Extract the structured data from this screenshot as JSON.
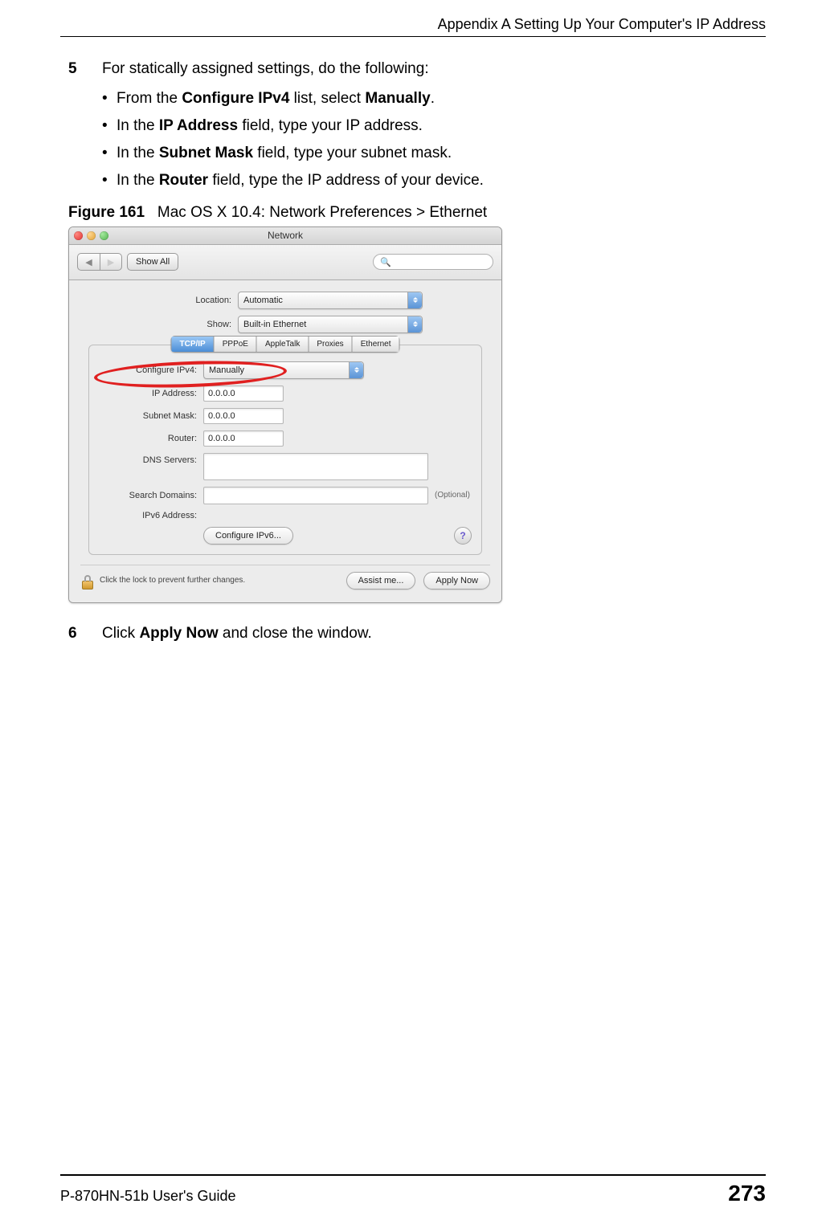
{
  "header": {
    "title": "Appendix A Setting Up Your Computer's IP Address"
  },
  "steps": {
    "step5": {
      "num": "5",
      "intro": "For statically assigned settings, do the following:",
      "bullets": [
        {
          "pre": "From the ",
          "bold1": "Configure IPv4",
          "mid": " list, select ",
          "bold2": "Manually",
          "post": "."
        },
        {
          "pre": "In the ",
          "bold1": "IP Address",
          "mid": " field, type your IP address.",
          "bold2": "",
          "post": ""
        },
        {
          "pre": "In the ",
          "bold1": "Subnet Mask",
          "mid": " field, type your subnet mask.",
          "bold2": "",
          "post": ""
        },
        {
          "pre": "In the ",
          "bold1": "Router",
          "mid": " field, type the IP address of your device.",
          "bold2": "",
          "post": ""
        }
      ]
    },
    "step6": {
      "num": "6",
      "pre": "Click ",
      "bold": "Apply Now",
      "post": " and close the window."
    }
  },
  "figure": {
    "label": "Figure 161",
    "caption": "Mac OS X 10.4: Network Preferences > Ethernet"
  },
  "macwin": {
    "title": "Network",
    "toolbar": {
      "back": "◀",
      "fwd": "▶",
      "showall": "Show All",
      "search_placeholder": "Q"
    },
    "location": {
      "label": "Location:",
      "value": "Automatic"
    },
    "show": {
      "label": "Show:",
      "value": "Built-in Ethernet"
    },
    "tabs": [
      "TCP/IP",
      "PPPoE",
      "AppleTalk",
      "Proxies",
      "Ethernet"
    ],
    "fields": {
      "configure_label": "Configure IPv4:",
      "configure_value": "Manually",
      "ip_label": "IP Address:",
      "ip_value": "0.0.0.0",
      "subnet_label": "Subnet Mask:",
      "subnet_value": "0.0.0.0",
      "router_label": "Router:",
      "router_value": "0.0.0.0",
      "dns_label": "DNS Servers:",
      "search_label": "Search Domains:",
      "optional": "(Optional)",
      "ipv6_label": "IPv6 Address:",
      "configure6_btn": "Configure IPv6...",
      "help": "?"
    },
    "bottom": {
      "lock_text": "Click the lock to prevent further changes.",
      "assist": "Assist me...",
      "apply": "Apply Now"
    }
  },
  "footer": {
    "left": "P-870HN-51b User's Guide",
    "right": "273"
  }
}
